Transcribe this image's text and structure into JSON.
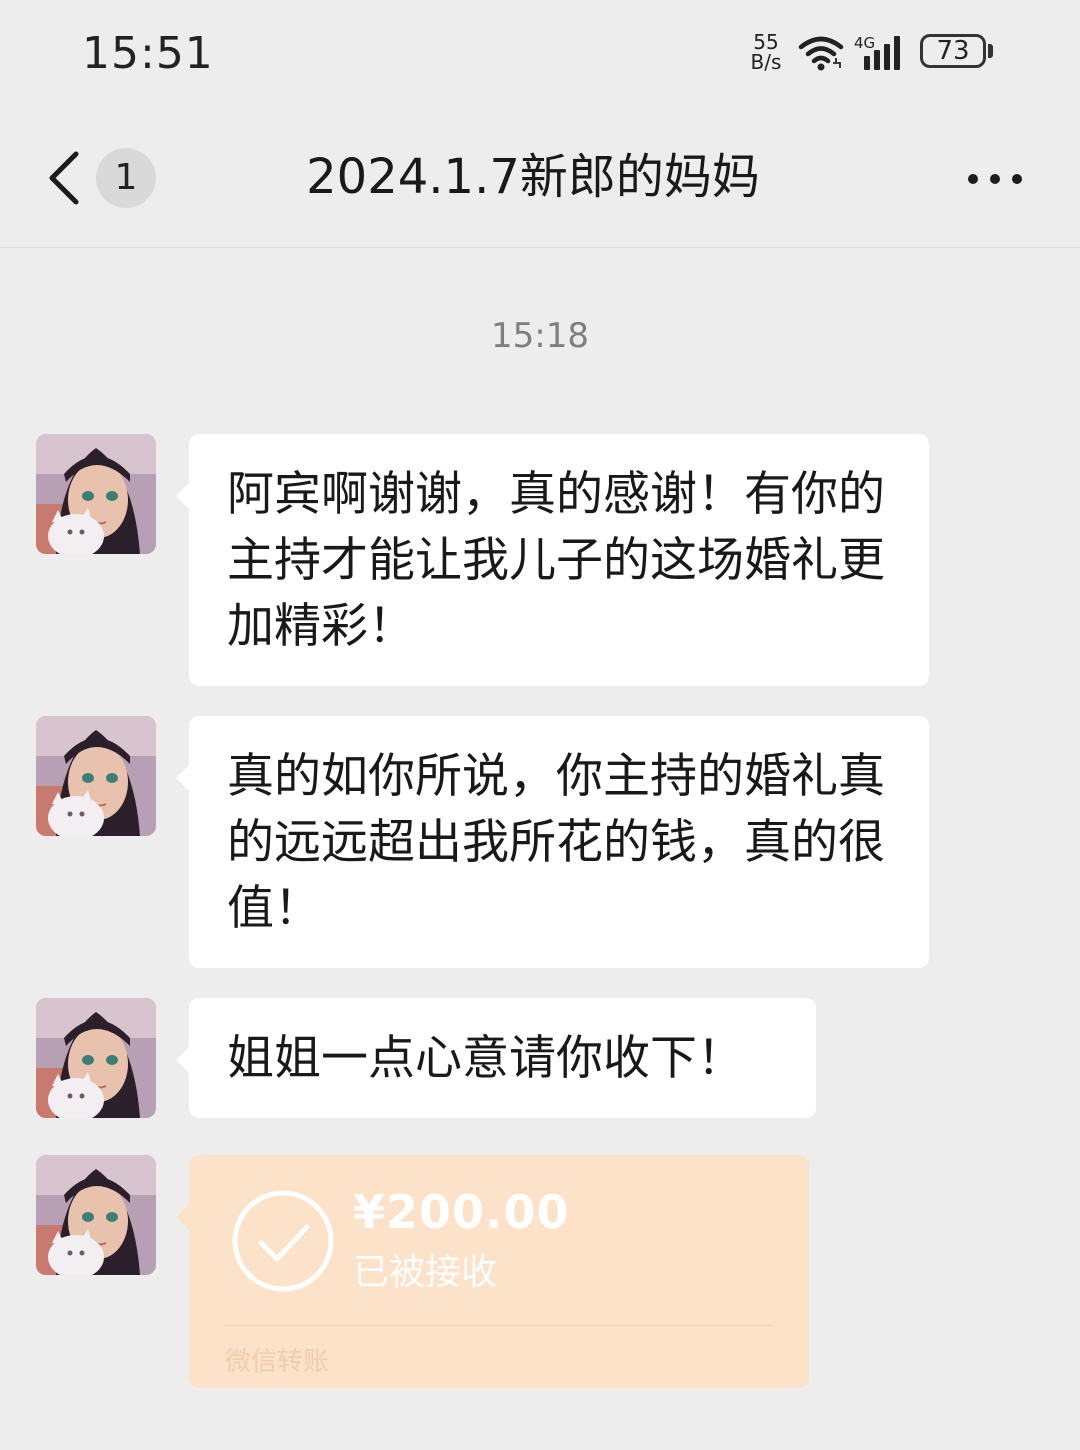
{
  "status_bar": {
    "time": "15:51",
    "net_speed_value": "55",
    "net_speed_unit": "B/s",
    "network_type": "4G",
    "battery": "73"
  },
  "header": {
    "unread_count": "1",
    "title": "2024.1.7新郎的妈妈"
  },
  "chat": {
    "timestamp": "15:18",
    "messages": [
      {
        "text": "阿宾啊谢谢，真的感谢！有你的主持才能让我儿子的这场婚礼更加精彩！"
      },
      {
        "text": "真的如你所说，你主持的婚礼真的远远超出我所花的钱，真的很值！"
      },
      {
        "text": "姐姐一点心意请你收下！"
      }
    ],
    "transfer": {
      "amount": "¥200.00",
      "status": "已被接收",
      "source": "微信转账"
    }
  },
  "colors": {
    "background": "#ededed",
    "bubble": "#ffffff",
    "transfer_card": "#fbe2c9"
  }
}
